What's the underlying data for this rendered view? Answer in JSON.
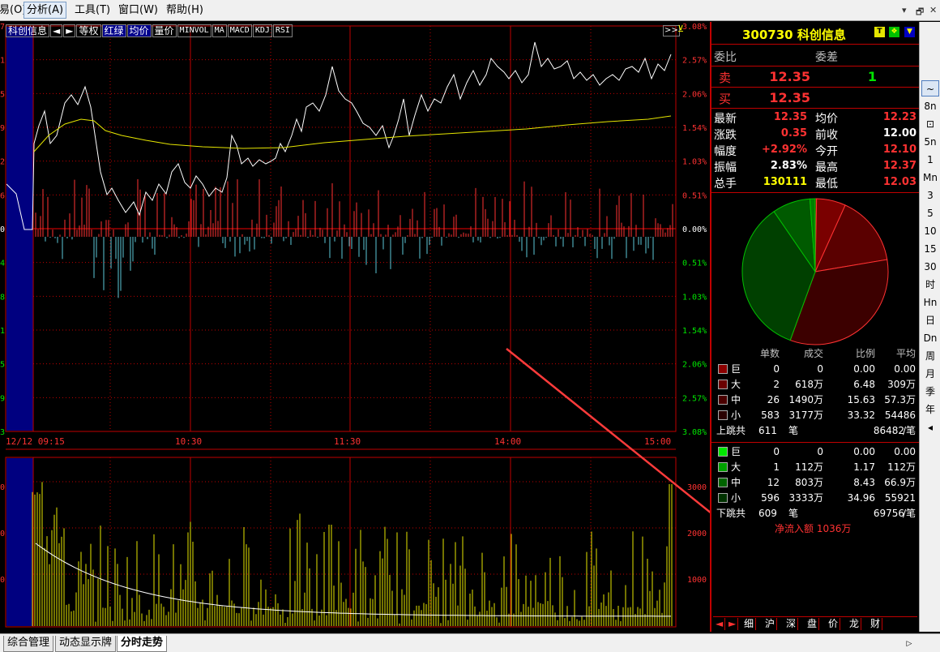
{
  "menubar": {
    "items": [
      "易(O)",
      "分析(A)",
      "工具(T)",
      "窗口(W)",
      "帮助(H)"
    ],
    "window_buttons": [
      "▾",
      "🗗",
      "✕"
    ]
  },
  "toolbar": {
    "stock": "科创信息",
    "prev": "◄",
    "next": "►",
    "buttons": [
      "等权",
      "红绿",
      "均价",
      "量价"
    ],
    "indicators": [
      "MINVOL",
      "MA",
      "MACD",
      "KDJ",
      "RSI"
    ],
    "expand": ">>",
    "pin": "⊻"
  },
  "colors": {
    "up": "#ff3232",
    "down": "#00e600",
    "price_line": "#ffffff",
    "avg_line": "#e6e600",
    "volume": "#e6e600",
    "buy_bar": "#ff3232",
    "sell_bar": "#5cc8d8",
    "grid": "#c00000",
    "highlight": "#ffff00"
  },
  "price_chart": {
    "left_labels": [
      "7",
      "1",
      "5",
      "9",
      "2",
      "6",
      "0",
      "4",
      "8",
      "1",
      "5",
      "9",
      "3"
    ],
    "right_labels": [
      "3.08%",
      "2.57%",
      "2.06%",
      "1.54%",
      "1.03%",
      "0.51%",
      "0.00%",
      "0.51%",
      "1.03%",
      "1.54%",
      "2.06%",
      "2.57%",
      "3.08%"
    ],
    "time_labels": [
      "12/12 09:15",
      "10:30",
      "11:30",
      "14:00",
      "15:00"
    ]
  },
  "volume_chart": {
    "left_labels": [
      "0",
      "0",
      "0"
    ],
    "right_labels": [
      "3000",
      "2000",
      "1000"
    ]
  },
  "quote": {
    "code": "300730",
    "name": "科创信息",
    "icons": [
      "T",
      "❖",
      "▼"
    ],
    "weibi_label": "委比",
    "weicha_label": "委差",
    "sell_label": "卖",
    "sell_price": "12.35",
    "sell_vol": "1",
    "buy_label": "买",
    "buy_price": "12.35",
    "stats": [
      {
        "l1": "最新",
        "v1": "12.35",
        "c1": "red",
        "l2": "均价",
        "v2": "12.23",
        "c2": "red"
      },
      {
        "l1": "涨跌",
        "v1": "0.35",
        "c1": "red",
        "l2": "前收",
        "v2": "12.00",
        "c2": "white"
      },
      {
        "l1": "幅度",
        "v1": "+2.92%",
        "c1": "red",
        "l2": "今开",
        "v2": "12.10",
        "c2": "red"
      },
      {
        "l1": "振幅",
        "v1": "2.83%",
        "c1": "white",
        "l2": "最高",
        "v2": "12.37",
        "c2": "red"
      },
      {
        "l1": "总手",
        "v1": "130111",
        "c1": "yellow",
        "l2": "最低",
        "v2": "12.03",
        "c2": "red"
      }
    ]
  },
  "pie": {
    "slices": [
      {
        "name": "巨-入",
        "value": 0.3,
        "color": "#8b0000"
      },
      {
        "name": "大-入",
        "value": 6.48,
        "color": "#7a0000"
      },
      {
        "name": "中-入",
        "value": 15.63,
        "color": "#5a0000"
      },
      {
        "name": "小-入",
        "value": 33.32,
        "color": "#3c0000"
      },
      {
        "name": "小-出",
        "value": 34.96,
        "color": "#004000"
      },
      {
        "name": "中-出",
        "value": 8.43,
        "color": "#005a00"
      },
      {
        "name": "大-出",
        "value": 1.17,
        "color": "#008000"
      }
    ]
  },
  "flow": {
    "headers": [
      "单数",
      "成交",
      "比例",
      "平均"
    ],
    "up_rows": [
      {
        "name": "巨",
        "color": "#8b0000",
        "count": "0",
        "amount": "0",
        "ratio": "0.00",
        "avg": "0.00"
      },
      {
        "name": "大",
        "color": "#6a0000",
        "count": "2",
        "amount": "618万",
        "ratio": "6.48",
        "avg": "309万"
      },
      {
        "name": "中",
        "color": "#4a0000",
        "count": "26",
        "amount": "1490万",
        "ratio": "15.63",
        "avg": "57.3万"
      },
      {
        "name": "小",
        "color": "#2a0000",
        "count": "583",
        "amount": "3177万",
        "ratio": "33.32",
        "avg": "54486"
      }
    ],
    "up_total": {
      "label": "上跳共",
      "count": "611",
      "unit": "笔",
      "avg": "86482",
      "per": "/笔"
    },
    "down_rows": [
      {
        "name": "巨",
        "color": "#00e600",
        "count": "0",
        "amount": "0",
        "ratio": "0.00",
        "avg": "0.00"
      },
      {
        "name": "大",
        "color": "#00a000",
        "count": "1",
        "amount": "112万",
        "ratio": "1.17",
        "avg": "112万"
      },
      {
        "name": "中",
        "color": "#006400",
        "count": "12",
        "amount": "803万",
        "ratio": "8.43",
        "avg": "66.9万"
      },
      {
        "name": "小",
        "color": "#003200",
        "count": "596",
        "amount": "3333万",
        "ratio": "34.96",
        "avg": "55921"
      }
    ],
    "down_total": {
      "label": "下跳共",
      "count": "609",
      "unit": "笔",
      "avg": "69756",
      "per": "/笔"
    },
    "net_inflow": "净流入额 1036万"
  },
  "panel_tabs": [
    "细",
    "沪",
    "深",
    "盘",
    "价",
    "龙",
    "财"
  ],
  "side_toolbar": [
    "~",
    "8n",
    "⊡",
    "5n",
    "1",
    "Mn",
    "3",
    "5",
    "10",
    "15",
    "30",
    "时",
    "Hn",
    "日",
    "Dn",
    "周",
    "月",
    "季",
    "年",
    "◂"
  ],
  "bottom_tabs": [
    "综合管理",
    "动态显示牌",
    "分时走势"
  ]
}
